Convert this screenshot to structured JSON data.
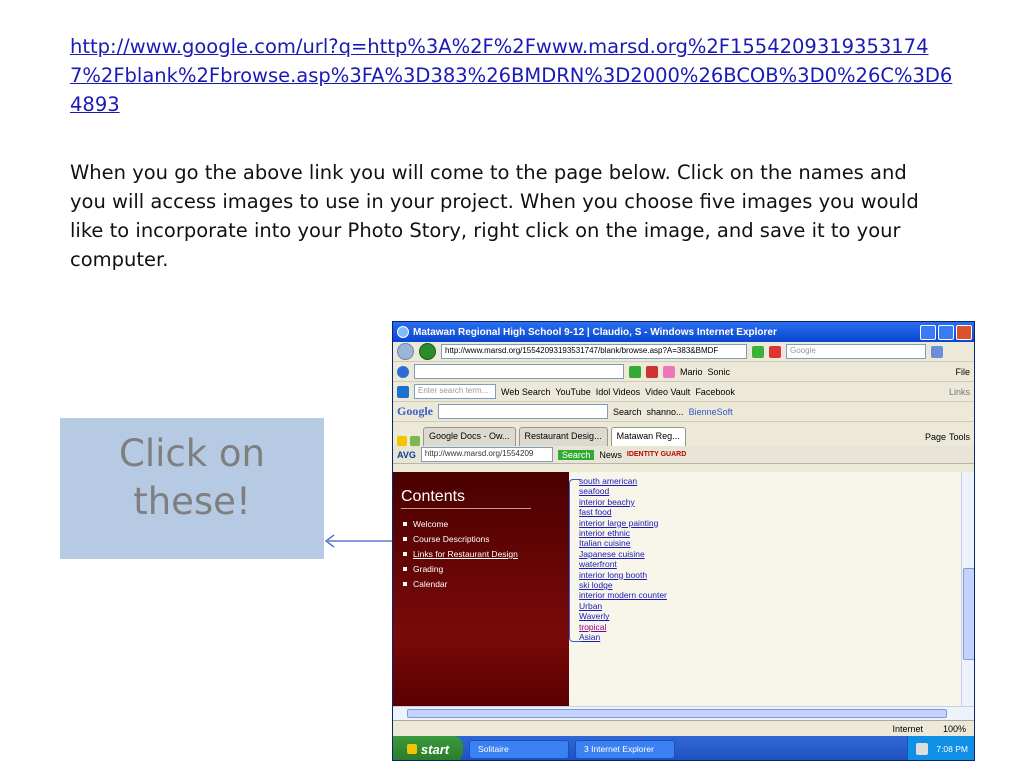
{
  "slide": {
    "link": "http://www.google.com/url?q=http%3A%2F%2Fwww.marsd.org%2F15542093193531747%2Fblank%2Fbrowse.asp%3FA%3D383%26BMDRN%3D2000%26BCOB%3D0%26C%3D64893",
    "instructions": "When you go the above link you will come to the page below.  Click on the names and you will access images to use in your project.  When you choose five images you would like to incorporate into your Photo Story, right click on the image, and save it to your computer.",
    "callout": "Click on these!"
  },
  "browser": {
    "title": "Matawan Regional High School 9-12 | Claudio, S - Windows Internet Explorer",
    "address": "http://www.marsd.org/15542093193531747/blank/browse.asp?A=383&BMDF",
    "search_placeholder": "Google",
    "toolbar1": [
      "Mario",
      "Sonic",
      "File",
      "Links"
    ],
    "toolbar2_placeholder": "Enter search term...",
    "toolbar2": [
      "Web Search",
      "YouTube",
      "Idol Videos",
      "Video Vault",
      "Facebook"
    ],
    "google_label": "Google",
    "toolbar3": [
      "Search",
      "shanno...",
      "BienneSoft"
    ],
    "tabs": [
      "Google Docs - Ow...",
      "Restaurant Desig...",
      "Matawan Reg..."
    ],
    "tab_actions": [
      "Page",
      "Tools"
    ],
    "avg": {
      "label": "AVG",
      "url": "http://www.marsd.org/1554209",
      "search": "Search",
      "news": "News",
      "identity": "IDENTITY GUARD"
    }
  },
  "page": {
    "contents_title": "Contents",
    "menu": [
      "Welcome",
      "Course Descriptions",
      "Links for Restaurant Design",
      "Grading",
      "Calendar"
    ],
    "links": [
      "south american",
      "seafood",
      "interior beachy",
      "fast food",
      "interior large painting",
      "interior ethnic",
      "Italian cuisine",
      "Japanese cuisine",
      "waterfront",
      "interior long booth",
      "ski lodge",
      "interior modern counter",
      "Urban",
      "Waverly",
      "tropical",
      "Asian"
    ]
  },
  "status": {
    "zone": "Internet",
    "zoom": "100%"
  },
  "taskbar": {
    "start": "start",
    "tasks": [
      "Solitaire",
      "3 Internet Explorer"
    ],
    "clock": "7:08 PM"
  }
}
